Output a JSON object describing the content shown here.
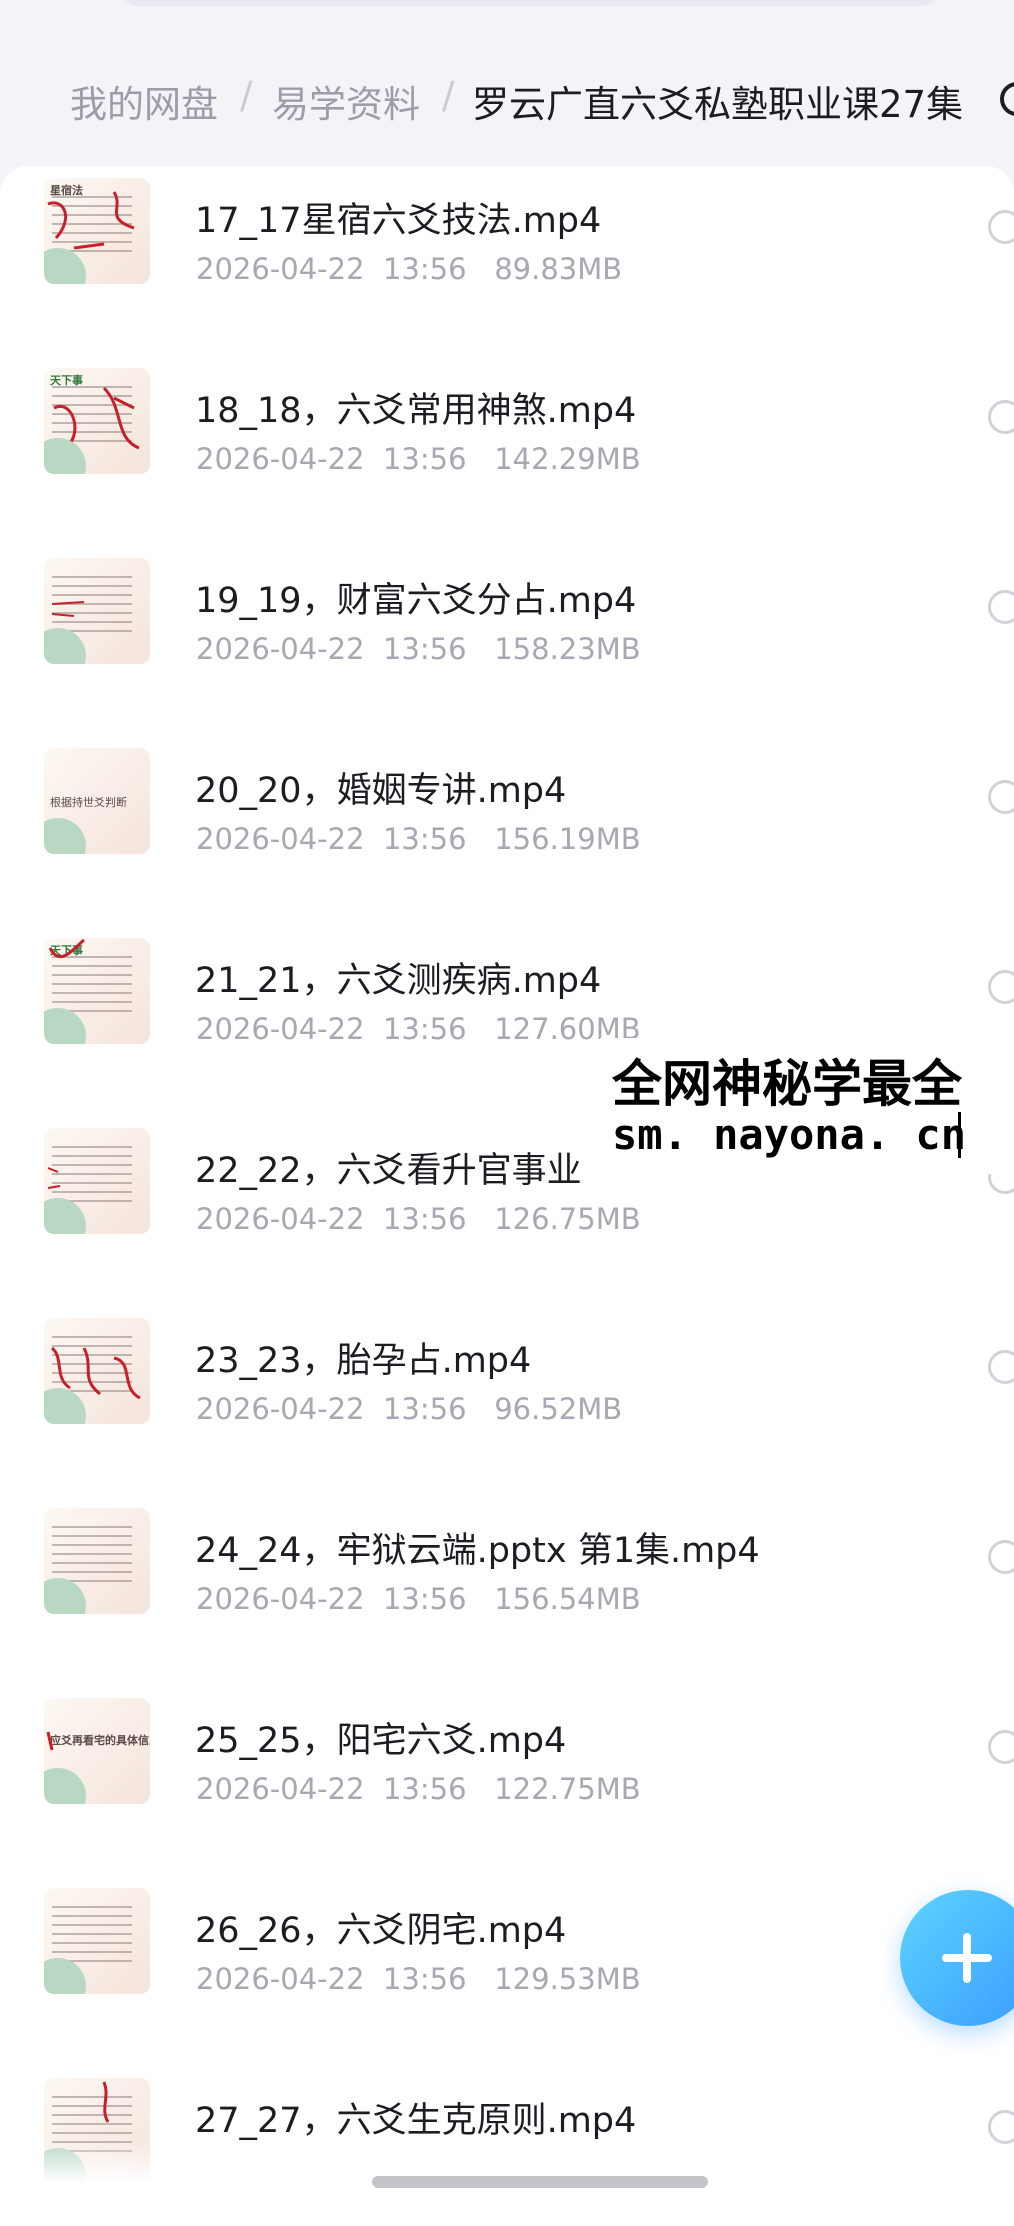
{
  "breadcrumb": {
    "root": "我的网盘",
    "separator": "/",
    "parent": "易学资料",
    "current": "罗云广直六爻私塾职业课27集"
  },
  "files": [
    {
      "name": "17_17星宿六爻技法.mp4",
      "date": "2026-04-22",
      "time": "13:56",
      "size": "89.83MB"
    },
    {
      "name": "18_18，六爻常用神煞.mp4",
      "date": "2026-04-22",
      "time": "13:56",
      "size": "142.29MB"
    },
    {
      "name": "19_19，财富六爻分占.mp4",
      "date": "2026-04-22",
      "time": "13:56",
      "size": "158.23MB"
    },
    {
      "name": "20_20，婚姻专讲.mp4",
      "date": "2026-04-22",
      "time": "13:56",
      "size": "156.19MB"
    },
    {
      "name": "21_21，六爻测疾病.mp4",
      "date": "2026-04-22",
      "time": "13:56",
      "size": "127.60MB"
    },
    {
      "name": "22_22，六爻看升官事业",
      "date": "2026-04-22",
      "time": "13:56",
      "size": "126.75MB"
    },
    {
      "name": "23_23，胎孕占.mp4",
      "date": "2026-04-22",
      "time": "13:56",
      "size": "96.52MB"
    },
    {
      "name": "24_24，牢狱云端.pptx 第1集.mp4",
      "date": "2026-04-22",
      "time": "13:56",
      "size": "156.54MB"
    },
    {
      "name": "25_25，阳宅六爻.mp4",
      "date": "2026-04-22",
      "time": "13:56",
      "size": "122.75MB"
    },
    {
      "name": "26_26，六爻阴宅.mp4",
      "date": "2026-04-22",
      "time": "13:56",
      "size": "129.53MB"
    },
    {
      "name": "27_27，六爻生克原则.mp4"
    }
  ],
  "thumbnails": {
    "file_17": "星宿法",
    "file_18": "天下事",
    "file_20": "根据持世爻判断",
    "file_21": "天下事",
    "file_25": "应爻再看宅的具体信息"
  },
  "watermark": {
    "line1": "全网神秘学最全",
    "line2": "sm. nayona. cn"
  },
  "fab": {
    "icon": "plus-icon"
  },
  "colors": {
    "background": "#f3f4f8",
    "panel": "#ffffff",
    "fab_start": "#5dd4ff",
    "fab_end": "#3a9dff",
    "meta_text": "#a6a9b1"
  }
}
